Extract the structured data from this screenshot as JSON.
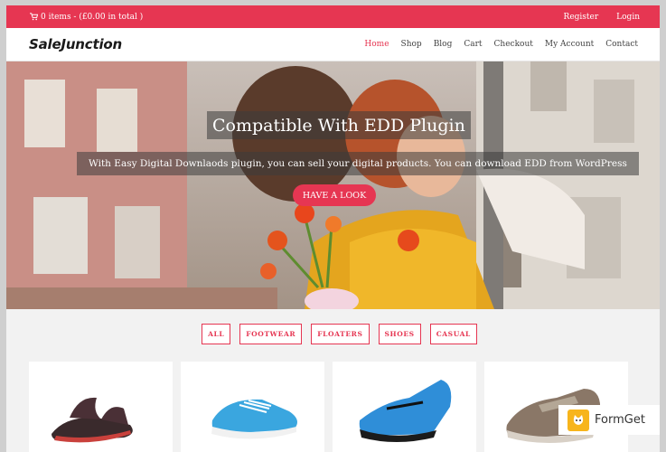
{
  "topbar": {
    "cart_text": "0 items - (£0.00 in total )",
    "register": "Register",
    "login": "Login"
  },
  "brand": {
    "logo": "SaleJunction"
  },
  "menu": [
    {
      "label": "Home"
    },
    {
      "label": "Shop"
    },
    {
      "label": "Blog"
    },
    {
      "label": "Cart"
    },
    {
      "label": "Checkout"
    },
    {
      "label": "My Account"
    },
    {
      "label": "Contact"
    }
  ],
  "hero": {
    "title": "Compatible With EDD Plugin",
    "subtitle": "With Easy Digital Downlaods plugin, you can sell your digital products. You can download EDD from WordPress",
    "button": "HAVE A LOOK"
  },
  "filters": [
    {
      "label": "ALL"
    },
    {
      "label": "FOOTWEAR"
    },
    {
      "label": "FLOATERS"
    },
    {
      "label": "SHOES"
    },
    {
      "label": "CASUAL"
    }
  ],
  "watermark": {
    "text": "FormGet"
  },
  "colors": {
    "accent": "#e63652",
    "background": "#f2f2f2"
  }
}
